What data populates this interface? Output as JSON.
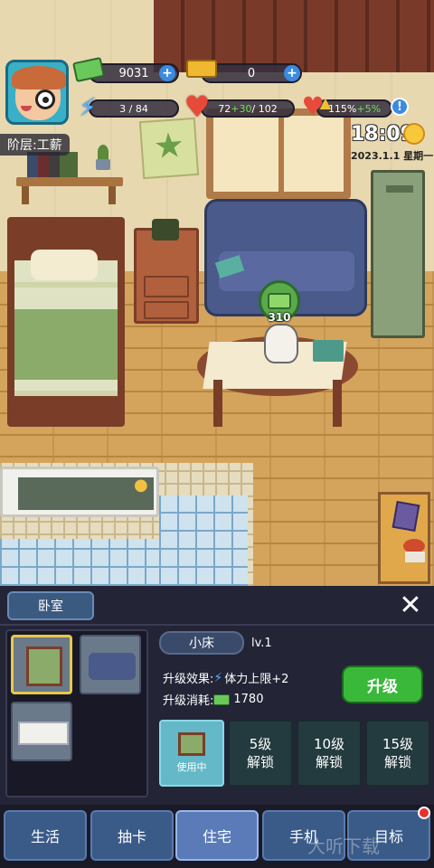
{
  "hud": {
    "cash": "9031",
    "gold": "0",
    "energy": "3 / 84",
    "health_current": "72",
    "health_bonus": "+30",
    "health_max": "/ 102",
    "mood_pct": "115%",
    "mood_bonus": "+5%",
    "plus_symbol": "+",
    "info_symbol": "!",
    "rank": "阶层:工薪",
    "time": "18:09",
    "date": "2023.1.1",
    "weekday": "星期一"
  },
  "scene": {
    "coin_value": "310"
  },
  "panel": {
    "room_tab": "卧室",
    "close_symbol": "✕",
    "item_name": "小床",
    "item_level": "lv.1",
    "effect_label": "升级效果:",
    "effect_value": "体力上限+2",
    "cost_label": "升级消耗:",
    "cost_value": "1780",
    "upgrade_button": "升级",
    "level_cards": [
      {
        "line1": "",
        "line2": "使用中"
      },
      {
        "line1": "5级",
        "line2": "解锁"
      },
      {
        "line1": "10级",
        "line2": "解锁"
      },
      {
        "line1": "15级",
        "line2": "解锁"
      }
    ]
  },
  "nav": {
    "tabs": [
      "生活",
      "抽卡",
      "住宅",
      "手机",
      "目标"
    ],
    "active": "住宅"
  },
  "watermark": "大听下载",
  "colors": {
    "accent_green": "#3ab83a",
    "nav_blue": "#3a5a88",
    "panel_bg": "#232436"
  },
  "icons": {
    "cash": "cash-icon",
    "gold": "gold-bar-icon",
    "energy": "lightning-bolt-icon",
    "health": "heart-icon",
    "mood": "heart-up-arrow-icon",
    "weather": "sun-icon"
  }
}
